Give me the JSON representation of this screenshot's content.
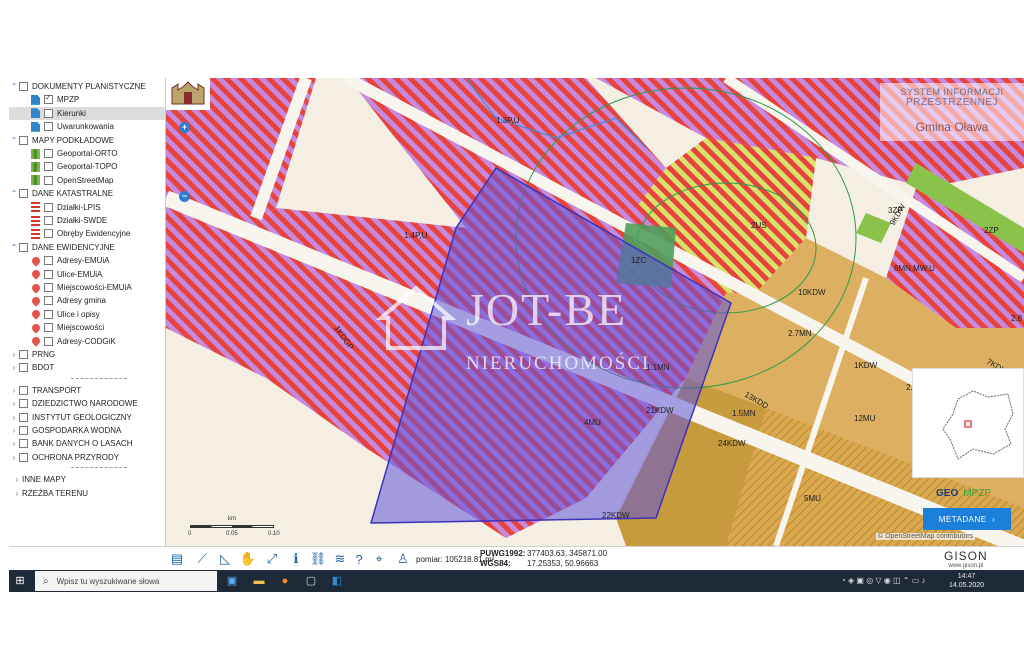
{
  "colors": {
    "accent": "#1c7fd9",
    "zone_red": "#e8423c",
    "zone_purple": "#c58adf",
    "zone_tan": "#dcb060",
    "zone_green": "#8bc34a",
    "selection": "#5e54d8"
  },
  "layers": [
    {
      "label": "DOKUMENTY PLANISTYCZNE",
      "kind": "group",
      "expanded": true,
      "checked": false
    },
    {
      "label": "MPZP",
      "kind": "item",
      "icon": "document-icon",
      "checked": true
    },
    {
      "label": "Kierunki",
      "kind": "item",
      "icon": "document-icon",
      "checked": false,
      "selected": true
    },
    {
      "label": "Uwarunkowania",
      "kind": "item",
      "icon": "document-icon",
      "checked": false
    },
    {
      "label": "MAPY PODKŁADOWE",
      "kind": "group",
      "expanded": true,
      "checked": false
    },
    {
      "label": "Geoportal-ORTO",
      "kind": "item",
      "icon": "map-icon",
      "checked": false
    },
    {
      "label": "Geoportal-TOPO",
      "kind": "item",
      "icon": "map-icon",
      "checked": false
    },
    {
      "label": "OpenStreetMap",
      "kind": "item",
      "icon": "map-icon",
      "checked": false
    },
    {
      "label": "DANE KATASTRALNE",
      "kind": "group",
      "expanded": true,
      "checked": false
    },
    {
      "label": "Działki-LPIS",
      "kind": "item",
      "icon": "list-icon",
      "checked": false
    },
    {
      "label": "Działki-SWDE",
      "kind": "item",
      "icon": "list-icon",
      "checked": false
    },
    {
      "label": "Obręby Ewidencyjne",
      "kind": "item",
      "icon": "list-icon",
      "checked": false
    },
    {
      "label": "DANE EWIDENCYJNE",
      "kind": "group",
      "expanded": true,
      "checked": false
    },
    {
      "label": "Adresy-EMUiA",
      "kind": "item",
      "icon": "pin-icon",
      "checked": false
    },
    {
      "label": "Ulice-EMUiA",
      "kind": "item",
      "icon": "pin-icon",
      "checked": false
    },
    {
      "label": "Miejscowości-EMUiA",
      "kind": "item",
      "icon": "pin-icon",
      "checked": false
    },
    {
      "label": "Adresy gmina",
      "kind": "item",
      "icon": "pin-icon",
      "checked": false
    },
    {
      "label": "Ulice i opisy",
      "kind": "item",
      "icon": "pin-icon",
      "checked": false
    },
    {
      "label": "Miejscowości",
      "kind": "item",
      "icon": "pin-icon",
      "checked": false
    },
    {
      "label": "Adresy-CODGiK",
      "kind": "item",
      "icon": "pin-icon",
      "checked": false
    },
    {
      "label": "PRNG",
      "kind": "group",
      "expanded": false,
      "checked": false
    },
    {
      "label": "BDOT",
      "kind": "group",
      "expanded": false,
      "checked": false
    },
    {
      "label": "TRANSPORT",
      "kind": "group",
      "expanded": false,
      "checked": false,
      "gap": true
    },
    {
      "label": "DZIEDZICTWO NARODOWE",
      "kind": "group",
      "expanded": false,
      "checked": false
    },
    {
      "label": "INSTYTUT GEOLOGICZNY",
      "kind": "group",
      "expanded": false,
      "checked": false
    },
    {
      "label": "GOSPODARKA WODNA",
      "kind": "group",
      "expanded": false,
      "checked": false
    },
    {
      "label": "BANK DANYCH O LASACH",
      "kind": "group",
      "expanded": false,
      "checked": false
    },
    {
      "label": "OCHRONA PRZYRODY",
      "kind": "group",
      "expanded": false,
      "checked": false
    },
    {
      "label": "INNE MAPY",
      "kind": "plain",
      "gap": true
    },
    {
      "label": "RZEŹBA TERENU",
      "kind": "plain"
    }
  ],
  "map": {
    "system_line1": "SYSTEM INFORMACJI",
    "system_line2": "PRZESTRZENNEJ",
    "gmina": "Gmina Oława",
    "watermark_line1": "JOT-BE",
    "watermark_line2": "NIERUCHOMOŚCI",
    "zone_labels": [
      "1.3P,U",
      "1.4P,U",
      "2US",
      "1ZC",
      "3ZP",
      "9KDW",
      "2ZP",
      "6MN,MW,U",
      "2.8",
      "10KDW",
      "2.7MN",
      "1KDW",
      "7KDL",
      "1KDGP",
      "13KDD",
      "1.5MN",
      "2.8",
      "12MU",
      "21KDW",
      "4MU",
      "24KDW",
      "5MU",
      "22KDW",
      "1.1MN"
    ],
    "scale_unit": "km",
    "scale_ticks": [
      "0",
      "0.05",
      "0.10"
    ],
    "geo_label": "GEO",
    "mpzp_label": "MPZP",
    "metadane_label": "METADANE",
    "attribution": "© OpenStreetMap contributors"
  },
  "toolbar": {
    "icons": [
      "printer-icon",
      "measure-line-icon",
      "measure-area-icon",
      "pan-hand-icon",
      "extent-icon",
      "info-icon",
      "link-icon",
      "layers-icon",
      "help-icon",
      "location-icon",
      "person-icon"
    ],
    "pomiar_label": "pomiar: 105218.81 m²",
    "puwg_label": "PUWG1992:",
    "puwg_value": "377403.63, 345871.00",
    "wgs_label": "WGS84:",
    "wgs_value": "17.25353, 50.96663",
    "brand": "GISON",
    "brand_url": "www.gison.pl"
  },
  "taskbar": {
    "search_placeholder": "Wpisz tu wyszukiwane słowa",
    "time": "14:47",
    "date": "14.05.2020",
    "apps": [
      "task-view-icon",
      "file-explorer-icon",
      "firefox-icon",
      "store-icon",
      "outlook-icon"
    ]
  }
}
